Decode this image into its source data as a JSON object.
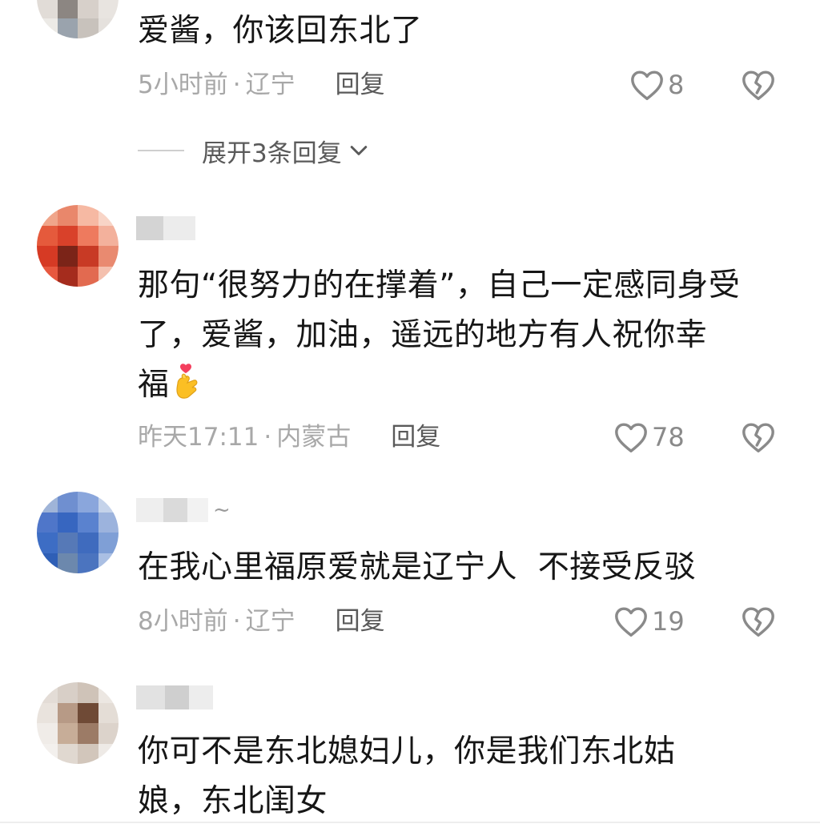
{
  "colors": {
    "text": "#161616",
    "meta": "#a8a8a8",
    "action": "#5a5a5a",
    "icon": "#8a8a8a"
  },
  "comments": [
    {
      "text": "爱酱，你该回东北了",
      "time": "5小时前",
      "location": "辽宁",
      "reply_label": "回复",
      "likes": "8",
      "expand_label": "展开3条回复"
    },
    {
      "text_line1": "那句“很努力的在撑着”，自己一定感同身受",
      "text_line2": "了，爱酱，加油，遥远的地方有人祝你幸",
      "text_line3": "福",
      "emoji": "finger-heart-emoji",
      "time": "昨天17:11",
      "location": "内蒙古",
      "reply_label": "回复",
      "likes": "78"
    },
    {
      "username_suffix": "~",
      "text": "在我心里福原爱就是辽宁人  不接受反驳",
      "time": "8小时前",
      "location": "辽宁",
      "reply_label": "回复",
      "likes": "19"
    },
    {
      "text_line1": "你可不是东北媳妇儿，你是我们东北姑",
      "text_line2": "娘，东北闺女"
    }
  ],
  "meta_separator": "·",
  "icons": {
    "like": "heart-outline-icon",
    "dislike": "broken-heart-icon",
    "expand": "chevron-down-icon"
  }
}
